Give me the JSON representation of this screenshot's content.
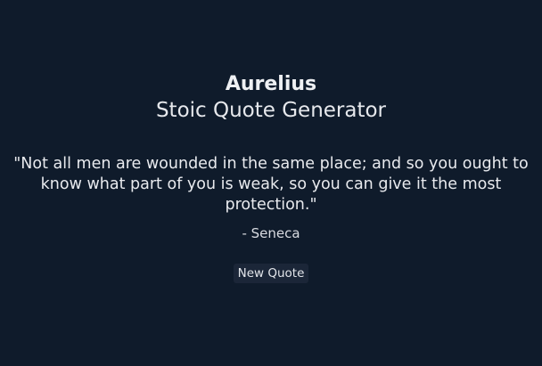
{
  "header": {
    "title": "Aurelius",
    "subtitle": "Stoic Quote Generator"
  },
  "quote": {
    "text": "\"Not all men are wounded in the same place; and so you ought to know what part of you is weak, so you can give it the most protection.\"",
    "author": "- Seneca"
  },
  "actions": {
    "new_quote_label": "New Quote"
  },
  "colors": {
    "background": "#0f1b2b",
    "text": "#e6e8ec",
    "button_background": "#1b2638"
  }
}
